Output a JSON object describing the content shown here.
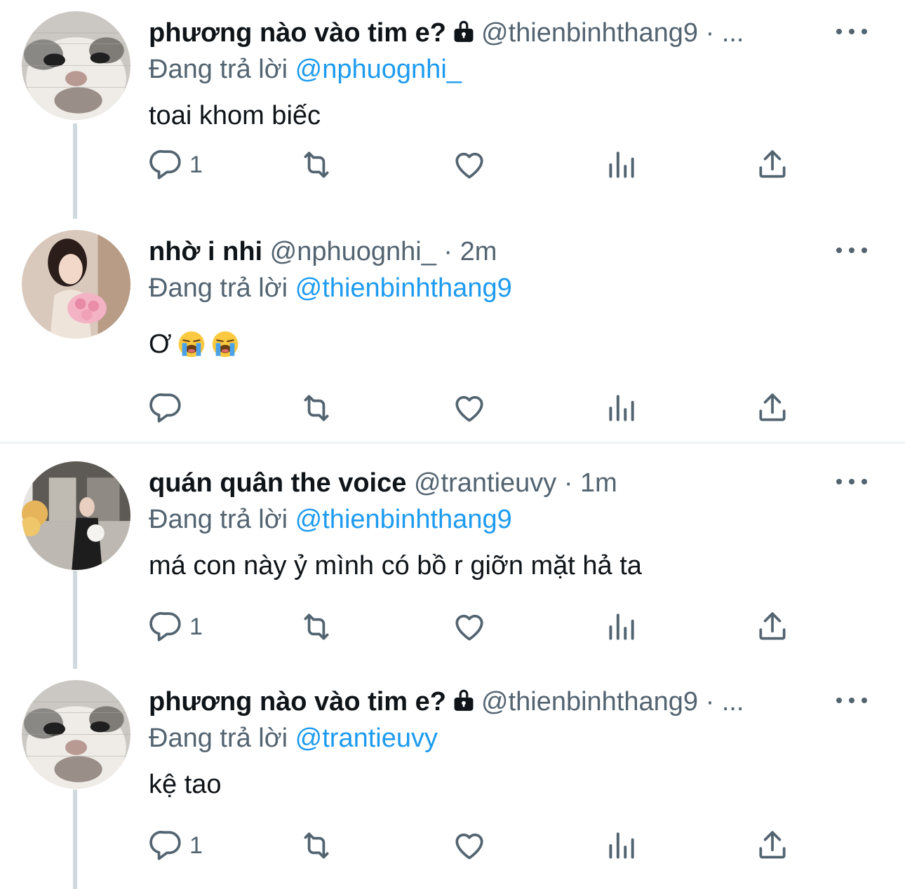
{
  "tweets": [
    {
      "name": "phương nào vào tim e?",
      "handle": "@thienbinhthang9 · ...",
      "replying_label": "Đang trả lời",
      "replying_to": "@nphuognhi_",
      "text": "toai khom biếc",
      "reply_count": "1",
      "avatar": "cat-closeup",
      "locked": true
    },
    {
      "name": "nhờ i nhi",
      "handle": "@nphuognhi_ · 2m",
      "replying_label": "Đang trả lời",
      "replying_to": "@thienbinhthang9",
      "text": "Ơ",
      "emoji": "loudly-crying-face",
      "reply_count": "",
      "avatar": "woman-with-flowers",
      "locked": false
    },
    {
      "name": "quán quân the voice",
      "handle": "@trantieuvy · 1m",
      "replying_label": "Đang trả lời",
      "replying_to": "@thienbinhthang9",
      "text": "má con này ỷ mình có bồ r giỡn mặt hả ta",
      "reply_count": "1",
      "avatar": "woman-with-dog",
      "locked": false
    },
    {
      "name": "phương nào vào tim e?",
      "handle": "@thienbinhthang9 · ...",
      "replying_label": "Đang trả lời",
      "replying_to": "@trantieuvy",
      "text": "kệ tao",
      "reply_count": "1",
      "avatar": "cat-closeup",
      "locked": true
    }
  ],
  "colors": {
    "mention": "#1d9bf0",
    "secondary_text": "#536471",
    "thread_line": "#cfd9de",
    "divider": "#eff3f4"
  },
  "icons": [
    "reply-icon",
    "retweet-icon",
    "like-icon",
    "views-icon",
    "share-icon",
    "lock-icon",
    "more-icon"
  ]
}
